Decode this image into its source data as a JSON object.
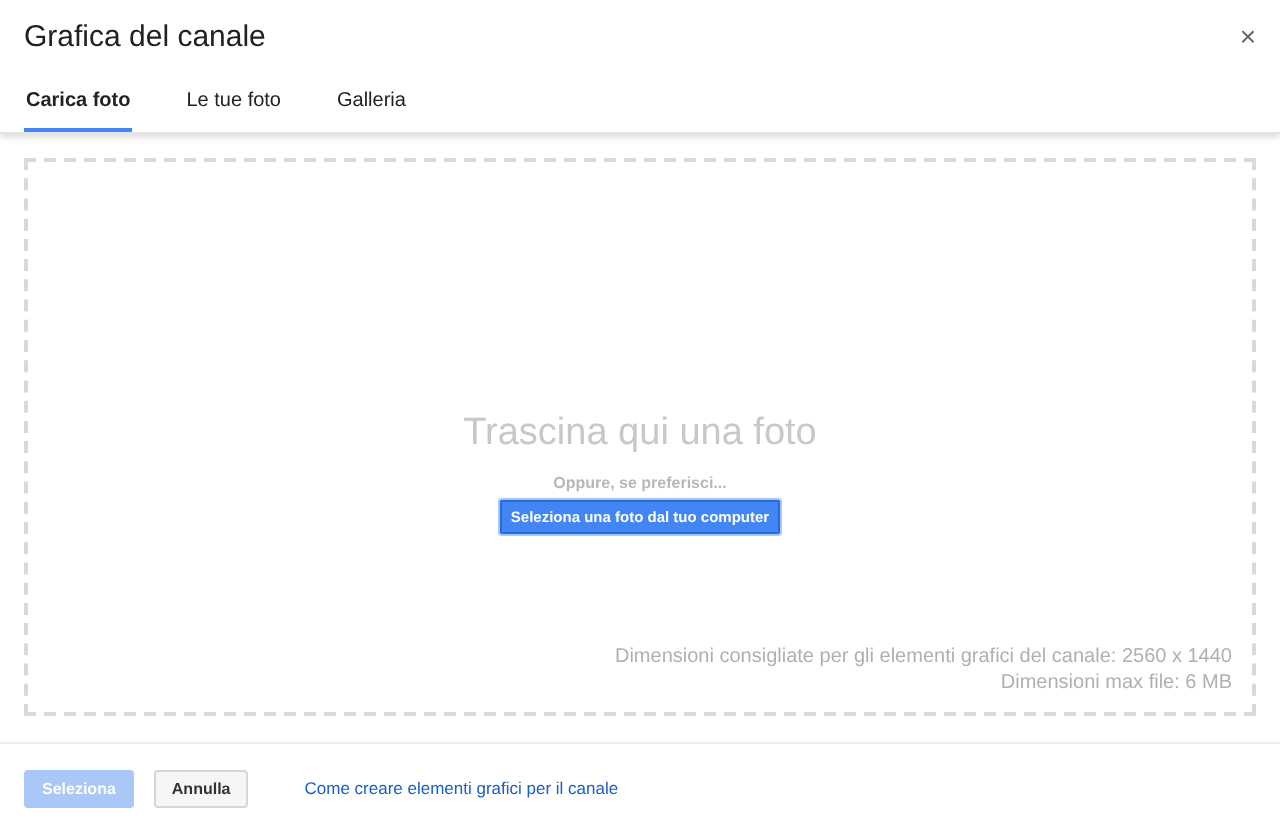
{
  "dialog": {
    "title": "Grafica del canale",
    "close": "×"
  },
  "tabs": [
    {
      "label": "Carica foto",
      "selected": true
    },
    {
      "label": "Le tue foto",
      "selected": false
    },
    {
      "label": "Galleria",
      "selected": false
    }
  ],
  "dropzone": {
    "heading": "Trascina qui una foto",
    "alternative": "Oppure, se preferisci...",
    "button": "Seleziona una foto dal tuo computer",
    "notes": [
      "Dimensioni consigliate per gli elementi grafici del canale: 2560 x 1440",
      "Dimensioni max file: 6 MB"
    ]
  },
  "footer": {
    "buttons": [
      {
        "label": "Seleziona",
        "disabled": true,
        "kind": "primary"
      },
      {
        "label": "Annulla",
        "disabled": false,
        "kind": "secondary"
      }
    ],
    "link": "Come creare elementi grafici per il canale"
  }
}
